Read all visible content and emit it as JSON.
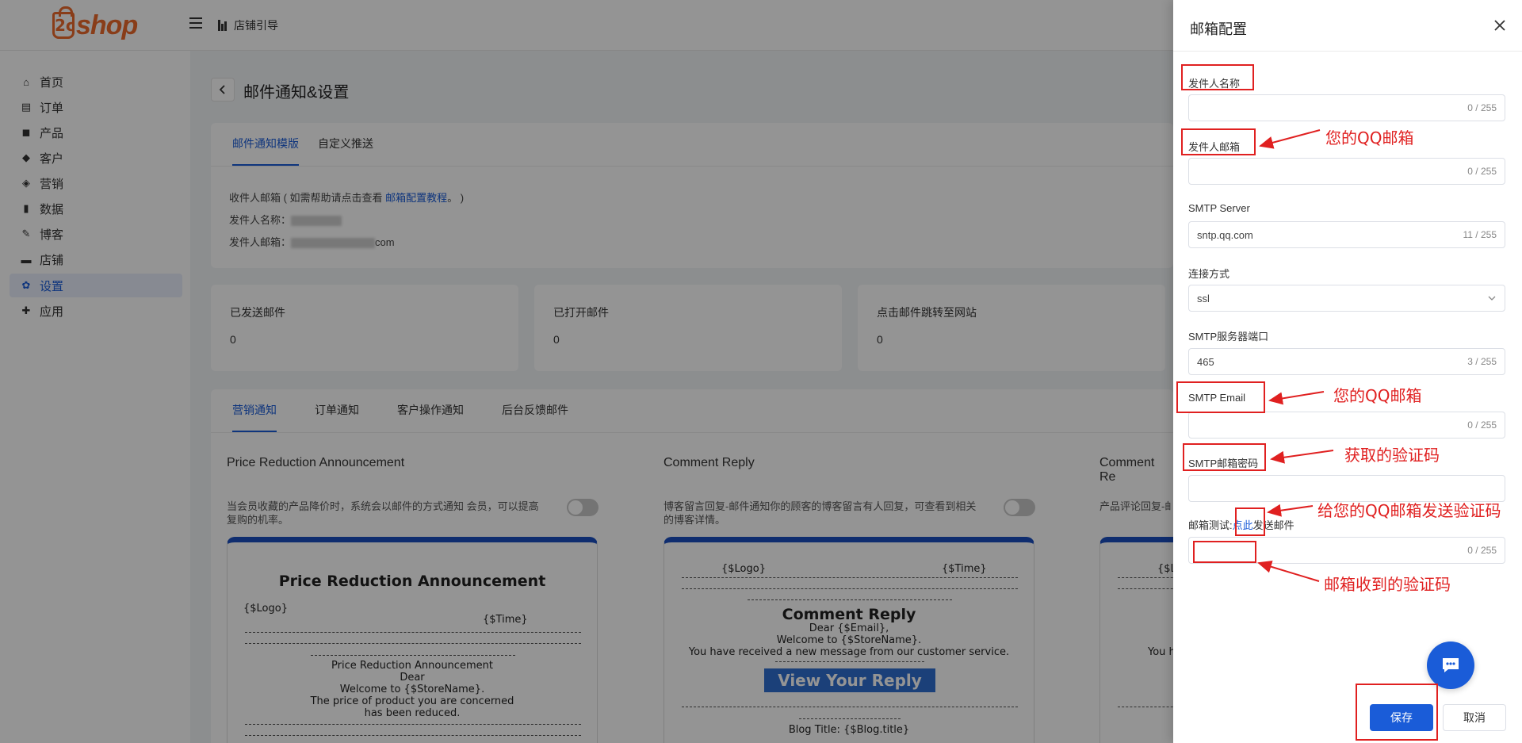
{
  "header": {
    "logo_text": "shop",
    "logo_mark": "2c",
    "guide_label": "店铺引导"
  },
  "sidebar": {
    "items": [
      {
        "label": "首页",
        "icon": "home-icon"
      },
      {
        "label": "订单",
        "icon": "order-icon"
      },
      {
        "label": "产品",
        "icon": "product-icon"
      },
      {
        "label": "客户",
        "icon": "customer-icon"
      },
      {
        "label": "营销",
        "icon": "marketing-icon"
      },
      {
        "label": "数据",
        "icon": "data-icon"
      },
      {
        "label": "博客",
        "icon": "blog-icon"
      },
      {
        "label": "店铺",
        "icon": "store-icon"
      },
      {
        "label": "设置",
        "icon": "settings-icon"
      },
      {
        "label": "应用",
        "icon": "apps-icon"
      }
    ],
    "active_index": 8
  },
  "page": {
    "title": "邮件通知&设置",
    "top_tabs": [
      "邮件通知模版",
      "自定义推送"
    ],
    "info": {
      "recipient_prefix": "收件人邮箱 ( 如需帮助请点击查看 ",
      "recipient_link": "邮箱配置教程",
      "recipient_suffix": "。 )",
      "sender_name_label": "发件人名称：",
      "sender_email_label": "发件人邮箱：",
      "sender_email_tail": "com"
    },
    "stats": [
      {
        "label": "已发送邮件",
        "value": "0"
      },
      {
        "label": "已打开邮件",
        "value": "0"
      },
      {
        "label": "点击邮件跳转至网站",
        "value": "0"
      }
    ],
    "notify_tabs": [
      "营销通知",
      "订单通知",
      "客户操作通知",
      "后台反馈邮件"
    ],
    "templates": [
      {
        "title": "Price Reduction Announcement",
        "desc": "当会员收藏的产品降价时，系统会以邮件的方式通知 会员，可以提高复购的机率。",
        "preview": {
          "heading": "Price Reduction Announcement",
          "logo": "{$Logo}",
          "time": "{$Time}",
          "subtitle": "Price Reduction Announcement",
          "dear": "Dear",
          "welcome": "Welcome to {$StoreName}.",
          "body1": "The price of product you are concerned",
          "body2": "has been reduced."
        }
      },
      {
        "title": "Comment Reply",
        "desc": "博客留言回复-邮件通知你的顾客的博客留言有人回复，可查看到相关的博客详情。",
        "preview": {
          "logo": "{$Logo}",
          "time": "{$Time}",
          "heading": "Comment Reply",
          "dear": "Dear {$Email},",
          "welcome": "Welcome to {$StoreName}.",
          "body1": "You have received a new message from our customer service.",
          "button": "View Your Reply",
          "blog_title": "Blog Title: {$Blog.title}"
        }
      },
      {
        "title": "Comment Re",
        "desc": "产品评论回复-邮件通知你的顾客的产品评论有人回复，可查看到相关的产品详情。",
        "preview": {
          "logo": "{$L",
          "body1": "You h"
        }
      }
    ]
  },
  "drawer": {
    "title": "邮箱配置",
    "fields": [
      {
        "label": "发件人名称",
        "value": "",
        "count": "0 / 255"
      },
      {
        "label": "发件人邮箱",
        "value": "",
        "count": "0 / 255"
      },
      {
        "label": "SMTP Server",
        "value": "sntp.qq.com",
        "count": "11 / 255"
      },
      {
        "label": "连接方式",
        "value": "ssl",
        "type": "select"
      },
      {
        "label": "SMTP服务器端口",
        "value": "465",
        "count": "3 / 255"
      },
      {
        "label": "SMTP Email",
        "value": "",
        "count": "0 / 255"
      },
      {
        "label": "SMTP邮箱密码",
        "value": "",
        "count": ""
      }
    ],
    "test": {
      "prefix": "邮箱测试:",
      "link": "点此",
      "suffix": "发送邮件",
      "count": "0 / 255"
    },
    "save_label": "保存",
    "cancel_label": "取消"
  },
  "annotations": {
    "qq_email_1": "您的QQ邮箱",
    "qq_email_2": "您的QQ邮箱",
    "auth_code": "获取的验证码",
    "send_code": "给您的QQ邮箱发送验证码",
    "received_code": "邮箱收到的验证码",
    "color": "#e02020"
  },
  "colors": {
    "brand": "#ed6a2c",
    "accent": "#1a5cd8",
    "annotation": "#e02020"
  }
}
